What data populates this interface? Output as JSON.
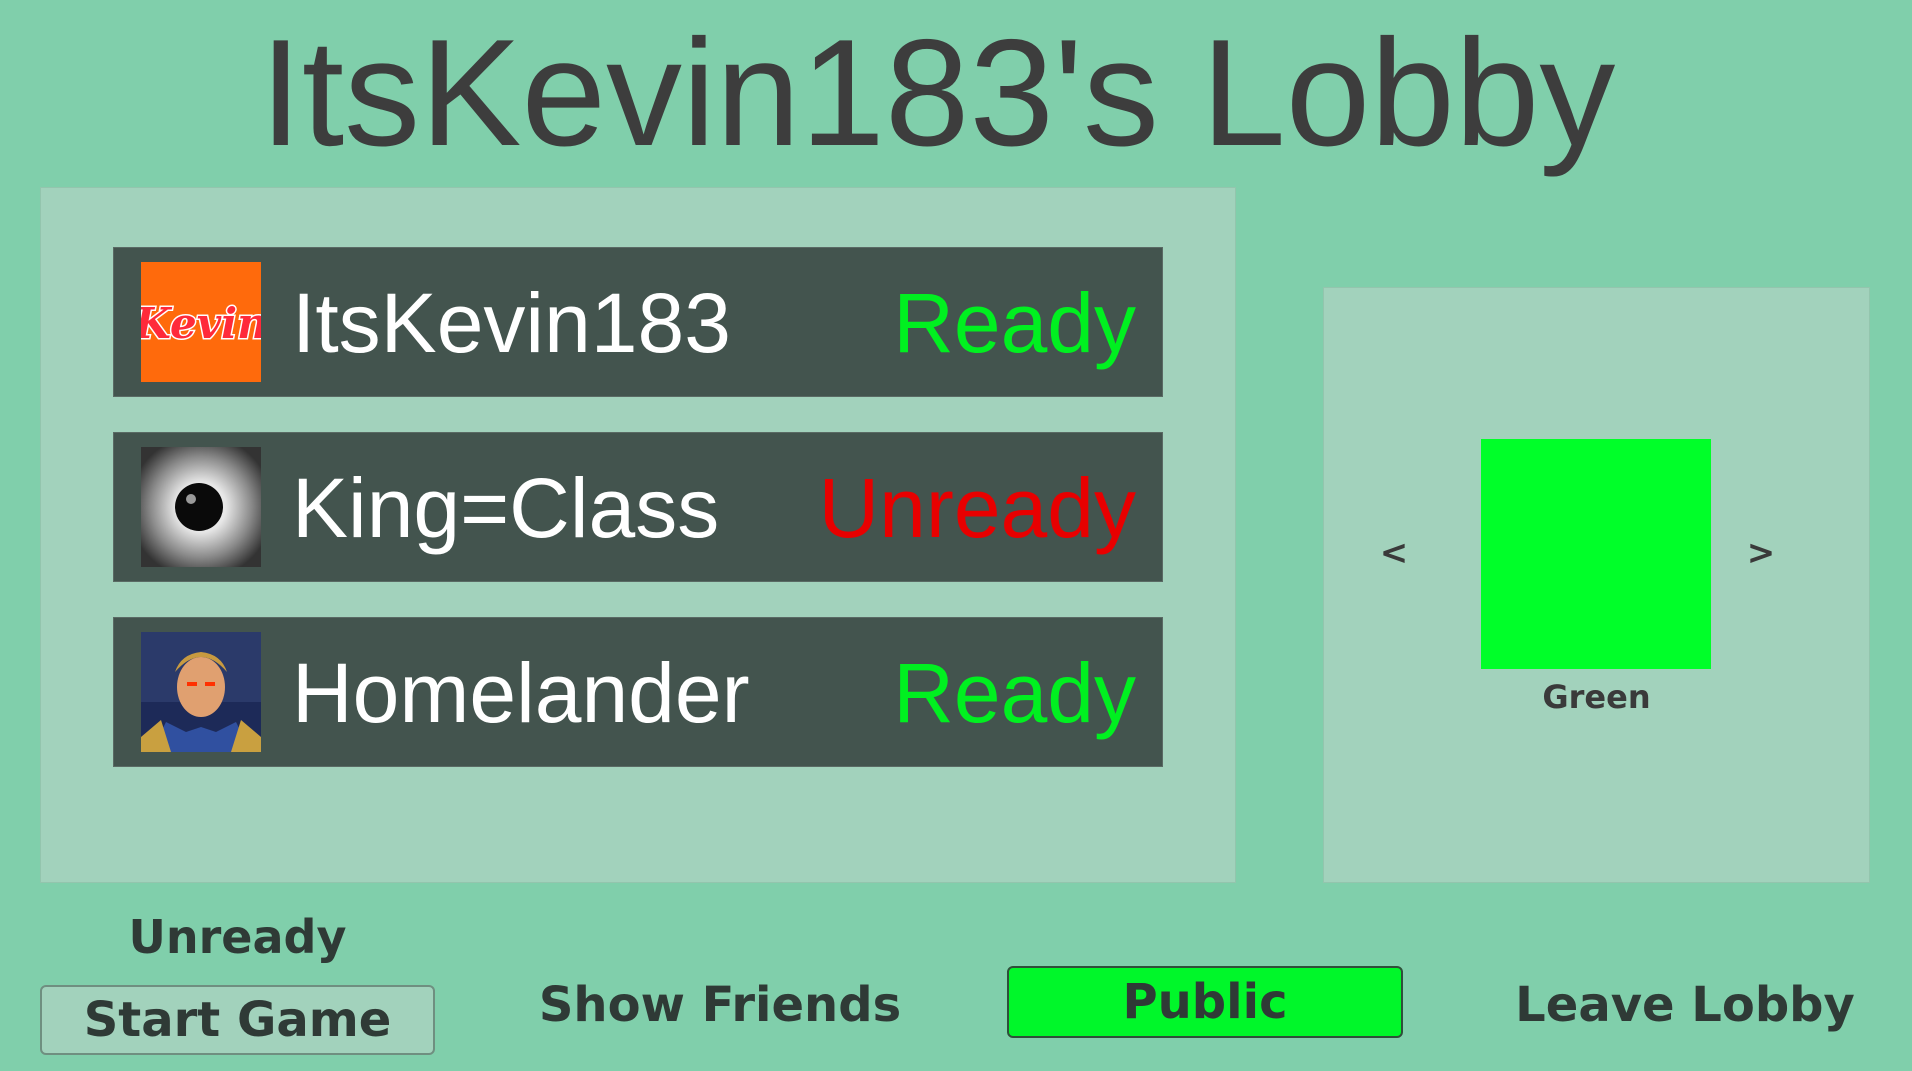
{
  "lobby": {
    "title": "ItsKevin183's Lobby"
  },
  "players": [
    {
      "name": "ItsKevin183",
      "status": "Ready",
      "status_color": "#00f020",
      "avatar": "kevin-logo-avatar"
    },
    {
      "name": "King=Class",
      "status": "Unready",
      "status_color": "#e80000",
      "avatar": "black-orb-avatar"
    },
    {
      "name": "Homelander",
      "status": "Ready",
      "status_color": "#00f020",
      "avatar": "homelander-avatar"
    }
  ],
  "color_picker": {
    "prev_label": "<",
    "next_label": ">",
    "color_name": "Green",
    "color_hex": "#00ff29"
  },
  "controls": {
    "ready_status": "Unready",
    "start_label": "Start Game",
    "friends_label": "Show Friends",
    "visibility_label": "Public",
    "leave_label": "Leave Lobby"
  },
  "colors": {
    "background": "#80cfab",
    "panel": "#a2d2bc",
    "row": "#43544e",
    "public_button": "#00f72a"
  }
}
